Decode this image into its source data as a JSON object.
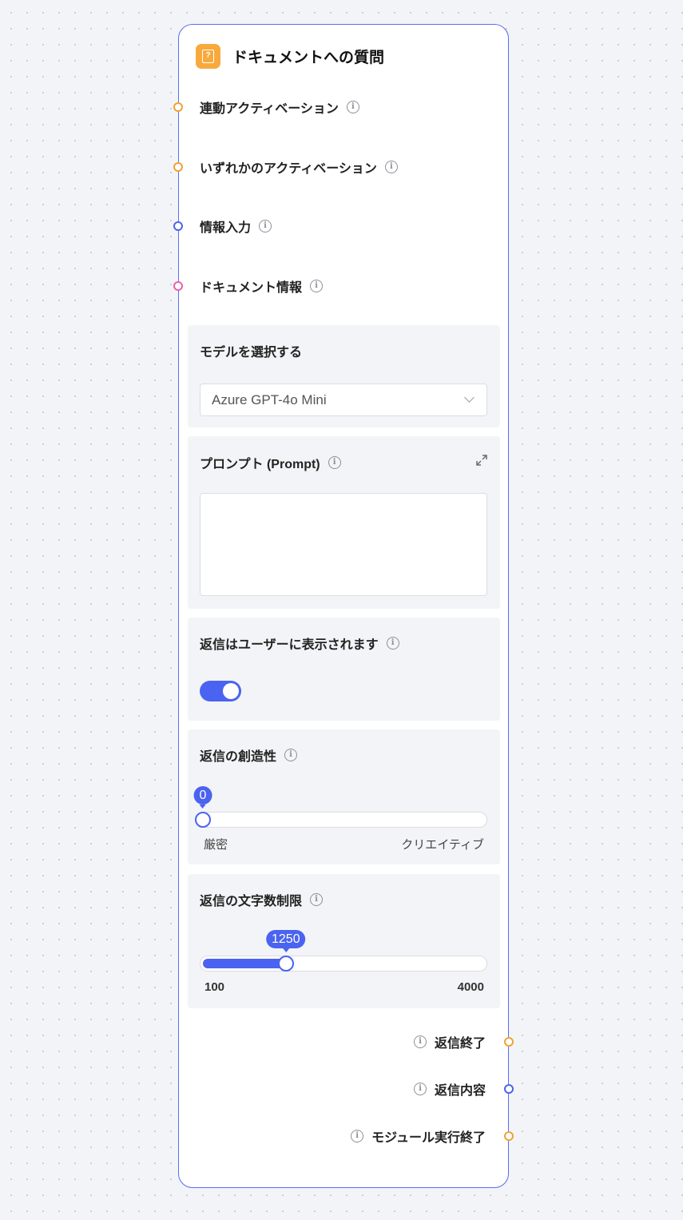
{
  "node": {
    "title": "ドキュメントへの質問",
    "icon": "document-question-icon",
    "accent_color": "#5b6cf5"
  },
  "inputs": [
    {
      "label": "連動アクティベーション",
      "port_color": "#f0a232"
    },
    {
      "label": "いずれかのアクティベーション",
      "port_color": "#f0a232"
    },
    {
      "label": "情報入力",
      "port_color": "#4a63f0"
    },
    {
      "label": "ドキュメント情報",
      "port_color": "#ee5fa8"
    }
  ],
  "model": {
    "label": "モデルを選択する",
    "selected": "Azure GPT-4o Mini"
  },
  "prompt": {
    "label": "プロンプト (Prompt)",
    "value": ""
  },
  "reply_visible": {
    "label": "返信はユーザーに表示されます",
    "enabled": true
  },
  "creativity": {
    "label": "返信の創造性",
    "value": "0",
    "min_label": "厳密",
    "max_label": "クリエイティブ",
    "fraction": 0
  },
  "max_chars": {
    "label": "返信の文字数制限",
    "value": "1250",
    "min": "100",
    "max": "4000",
    "fraction": 0.2949
  },
  "outputs": [
    {
      "label": "返信終了",
      "port_color": "#f0a232"
    },
    {
      "label": "返信内容",
      "port_color": "#4a63f0"
    },
    {
      "label": "モジュール実行終了",
      "port_color": "#f0a232"
    }
  ]
}
